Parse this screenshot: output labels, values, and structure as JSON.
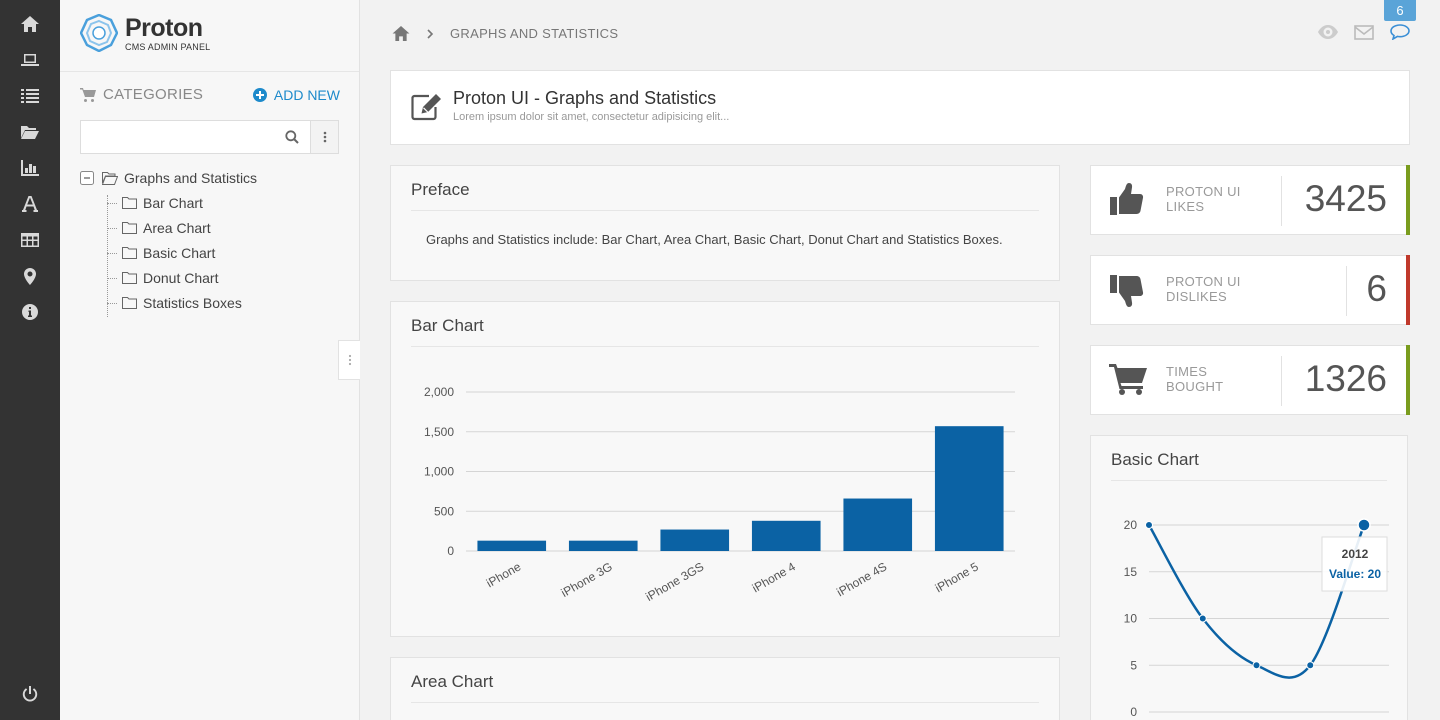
{
  "brand": {
    "name": "Proton",
    "tagline": "CMS ADMIN PANEL",
    "colors": {
      "accent": "#1d8acb",
      "bar": "#0b62a4",
      "likes": "#7a9c1e",
      "dislikes": "#c0392b"
    }
  },
  "rail": {
    "items": [
      "home-icon",
      "laptop-icon",
      "list-icon",
      "folder-open-icon",
      "bar-chart-icon",
      "font-icon",
      "table-icon",
      "map-marker-icon",
      "info-icon",
      "power-icon"
    ]
  },
  "sidebar": {
    "categories_label": "CATEGORIES",
    "add_new_label": "ADD NEW",
    "search": {
      "value": "",
      "placeholder": ""
    },
    "tree": {
      "root": "Graphs and Statistics",
      "children": [
        "Bar Chart",
        "Area Chart",
        "Basic Chart",
        "Donut Chart",
        "Statistics Boxes"
      ]
    }
  },
  "breadcrumb": {
    "current": "GRAPHS AND STATISTICS"
  },
  "topbar": {
    "notification_count": "6"
  },
  "page_header": {
    "title": "Proton UI - Graphs and Statistics",
    "subtitle": "Lorem ipsum dolor sit amet, consectetur adipisicing elit..."
  },
  "preface": {
    "title": "Preface",
    "text": "Graphs and Statistics include: Bar Chart, Area Chart, Basic Chart, Donut Chart and Statistics Boxes."
  },
  "bar_chart_card": {
    "title": "Bar Chart"
  },
  "area_chart_card": {
    "title": "Area Chart"
  },
  "basic_chart_card": {
    "title": "Basic Chart"
  },
  "stats": [
    {
      "label_line1": "PROTON UI",
      "label_line2": "LIKES",
      "value": "3425",
      "color": "#7a9c1e",
      "icon": "thumbs-up-icon"
    },
    {
      "label_line1": "PROTON UI",
      "label_line2": "DISLIKES",
      "value": "6",
      "color": "#c0392b",
      "icon": "thumbs-down-icon"
    },
    {
      "label_line1": "TIMES",
      "label_line2": "BOUGHT",
      "value": "1326",
      "color": "#7a9c1e",
      "icon": "shopping-cart-icon"
    }
  ],
  "chart_data": [
    {
      "type": "bar",
      "categories": [
        "iPhone",
        "iPhone 3G",
        "iPhone 3GS",
        "iPhone 4",
        "iPhone 4S",
        "iPhone 5"
      ],
      "values": [
        130,
        130,
        270,
        380,
        660,
        1570
      ],
      "ylim": [
        0,
        2000
      ],
      "yticks": [
        "0",
        "500",
        "1,000",
        "1,500",
        "2,000"
      ],
      "grid": true
    },
    {
      "type": "line",
      "x": [
        0,
        1,
        2,
        3,
        4
      ],
      "values": [
        20,
        10,
        5,
        5,
        20
      ],
      "ylim": [
        0,
        20
      ],
      "yticks": [
        "0",
        "5",
        "10",
        "15",
        "20"
      ],
      "tooltip": {
        "title": "2012",
        "text": "Value: 20"
      },
      "grid": true
    }
  ]
}
